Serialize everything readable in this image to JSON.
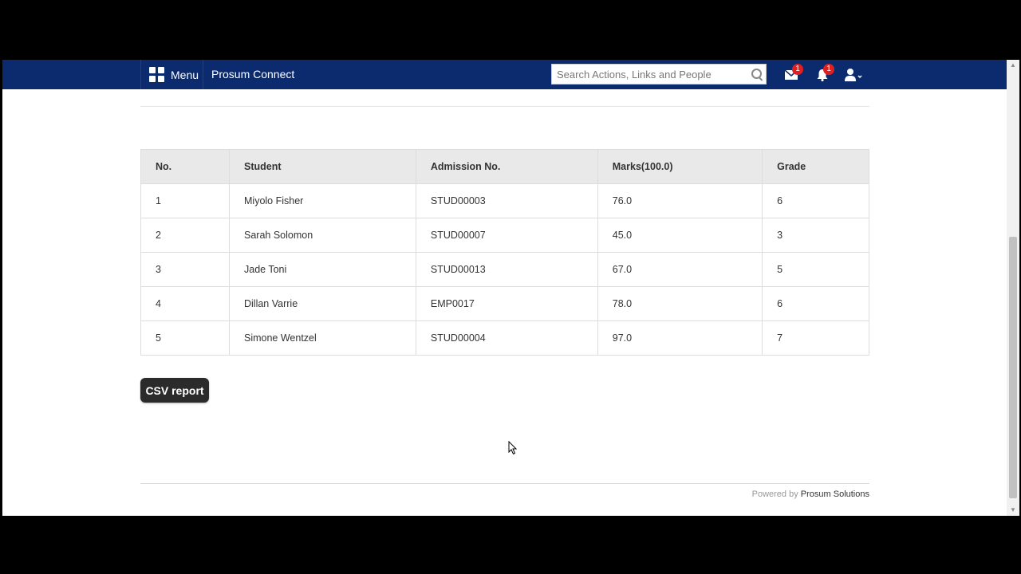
{
  "navbar": {
    "menu_label": "Menu",
    "brand": "Prosum Connect",
    "search_placeholder": "Search Actions, Links and People",
    "mail_badge": "1",
    "notifications_badge": "1",
    "icons": [
      "grid-icon",
      "search-icon",
      "mail-icon",
      "bell-icon",
      "user-icon"
    ]
  },
  "table": {
    "headers": [
      "No.",
      "Student",
      "Admission No.",
      "Marks(100.0)",
      "Grade"
    ],
    "rows": [
      [
        "1",
        "Miyolo Fisher",
        "STUD00003",
        "76.0",
        "6"
      ],
      [
        "2",
        "Sarah Solomon",
        "STUD00007",
        "45.0",
        "3"
      ],
      [
        "3",
        "Jade Toni",
        "STUD00013",
        "67.0",
        "5"
      ],
      [
        "4",
        "Dillan Varrie",
        "EMP0017",
        "78.0",
        "6"
      ],
      [
        "5",
        "Simone Wentzel",
        "STUD00004",
        "97.0",
        "7"
      ]
    ]
  },
  "csv_button": "CSV report",
  "footer": {
    "powered_by": "Powered by",
    "company": "Prosum Solutions"
  },
  "colors": {
    "navbar": "#0c2b6e",
    "badge": "#e02020",
    "button": "#2b2b2b"
  }
}
